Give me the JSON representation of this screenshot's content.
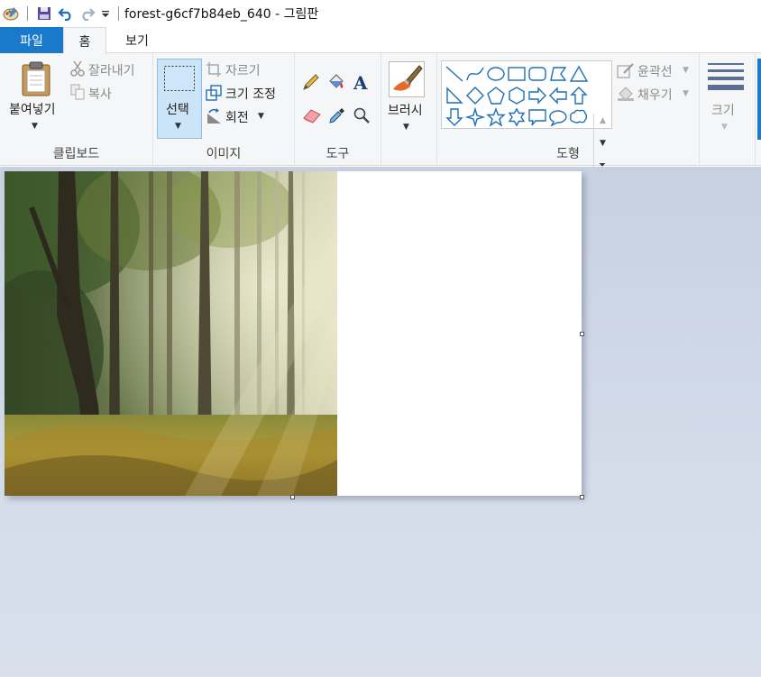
{
  "window": {
    "title": "forest-g6cf7b84eb_640 - 그림판"
  },
  "tabs": {
    "file": "파일",
    "home": "홈",
    "view": "보기"
  },
  "ribbon": {
    "clipboard": {
      "paste": "붙여넣기",
      "cut": "잘라내기",
      "copy": "복사",
      "group": "클립보드"
    },
    "image": {
      "select": "선택",
      "crop": "자르기",
      "resize": "크기 조정",
      "rotate": "회전",
      "group": "이미지"
    },
    "tools": {
      "group": "도구"
    },
    "brushes": {
      "label": "브러시"
    },
    "shapes": {
      "outline": "윤곽선",
      "fill": "채우기",
      "group": "도형"
    },
    "size": {
      "label": "크기"
    }
  },
  "colors": {
    "accent": "#1979ca",
    "ribbon_bg": "#f5f6f7",
    "select_active": "#cce4f7",
    "shape_stroke": "#1e6fb8"
  },
  "icons": [
    "paint-app-icon",
    "save-icon",
    "undo-icon",
    "redo-icon",
    "customize-icon",
    "paste-icon",
    "scissors-icon",
    "copy-icon",
    "select-icon",
    "crop-icon",
    "resize-icon",
    "rotate-icon",
    "pencil-icon",
    "fill-bucket-icon",
    "text-icon",
    "eraser-icon",
    "color-picker-icon",
    "magnifier-icon",
    "brush-icon",
    "outline-icon",
    "fill-icon",
    "size-lines-icon"
  ]
}
